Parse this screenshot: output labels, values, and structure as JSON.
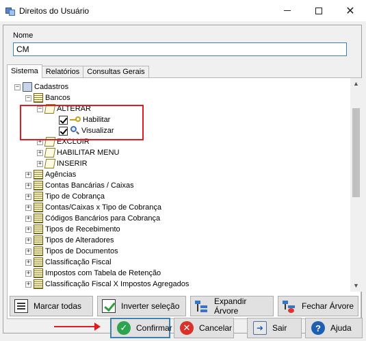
{
  "window": {
    "title": "Direitos do Usuário"
  },
  "form": {
    "name_label": "Nome",
    "name_value": "CM"
  },
  "tabs": [
    {
      "label": "Sistema",
      "active": true
    },
    {
      "label": "Relatórios",
      "active": false
    },
    {
      "label": "Consultas Gerais",
      "active": false
    }
  ],
  "tree": {
    "root": "Cadastros",
    "bancos": "Bancos",
    "alterar": "ALTERAR",
    "habilitar": "Habilitar",
    "visualizar": "Visualizar",
    "excluir": "EXCLUIR",
    "habilitar_menu": "HABILITAR MENU",
    "inserir": "INSERIR",
    "items": [
      "Agências",
      "Contas Bancárias / Caixas",
      "Tipo de Cobrança",
      "Contas/Caixas x Tipo de Cobrança",
      "Códigos Bancários para Cobrança",
      "Tipos de Recebimento",
      "Tipos de Alteradores",
      "Tipos de Documentos",
      "Classificação Fiscal",
      "Impostos com Tabela de Retenção",
      "Classificação Fiscal X Impostos Agregados"
    ]
  },
  "actions": {
    "marcar_todas": "Marcar todas",
    "inverter": "Inverter seleção",
    "expandir": "Expandir Árvore",
    "fechar": "Fechar Árvore"
  },
  "footer": {
    "confirmar": "Confirmar",
    "cancelar": "Cancelar",
    "sair": "Sair",
    "ajuda": "Ajuda"
  },
  "colors": {
    "highlight": "#e01b24",
    "focus_border": "#3c7fb1"
  }
}
